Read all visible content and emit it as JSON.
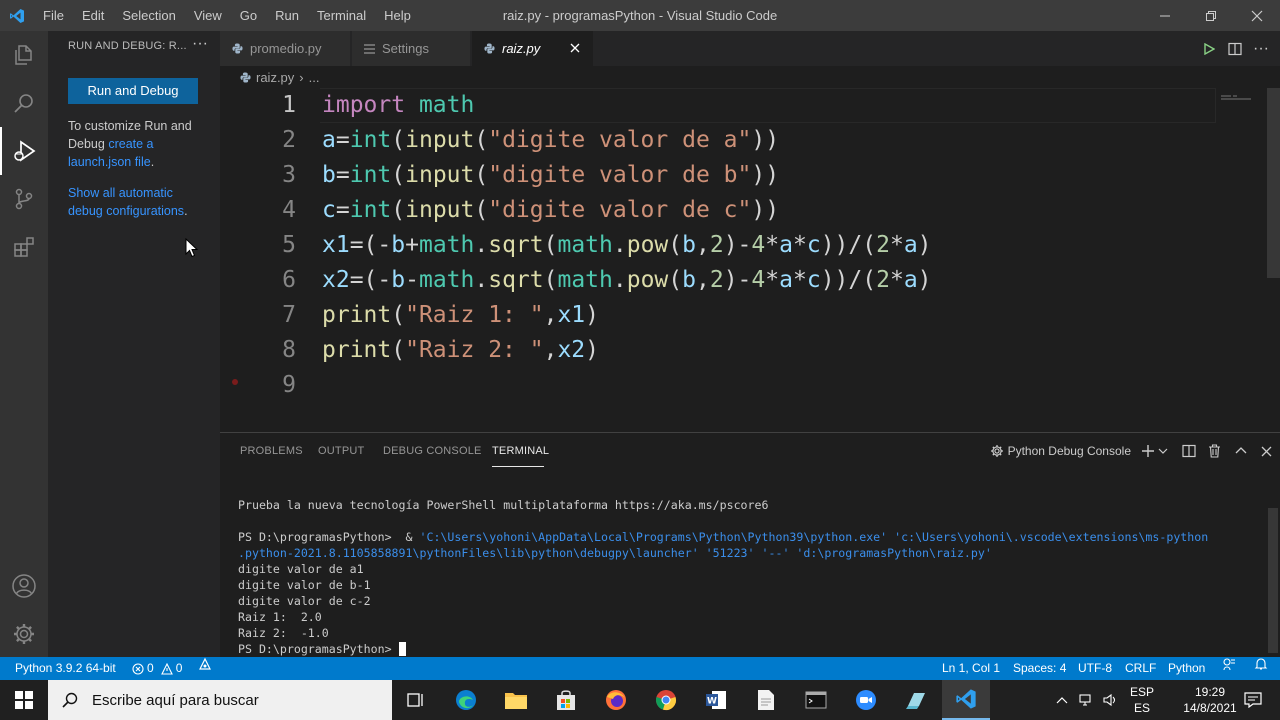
{
  "app": {
    "window_title": "raiz.py - programasPython - Visual Studio Code",
    "menu": [
      "File",
      "Edit",
      "Selection",
      "View",
      "Go",
      "Run",
      "Terminal",
      "Help"
    ]
  },
  "sidebar": {
    "title": "RUN AND DEBUG: R...",
    "run_debug_button": "Run and Debug",
    "text_prefix": "To customize Run and Debug",
    "create_link": "create a launch.json file",
    "text_suffix": ".",
    "show_link": "Show all automatic debug configurations",
    "show_suffix": "."
  },
  "tabs": [
    {
      "label": "promedio.py",
      "active": false
    },
    {
      "label": "Settings",
      "active": false
    },
    {
      "label": "raiz.py",
      "active": true
    }
  ],
  "breadcrumb": {
    "file": "raiz.py",
    "more": "..."
  },
  "editor": {
    "line_numbers": [
      "1",
      "2",
      "3",
      "4",
      "5",
      "6",
      "7",
      "8",
      "9"
    ]
  },
  "panel": {
    "tabs": [
      "PROBLEMS",
      "OUTPUT",
      "DEBUG CONSOLE",
      "TERMINAL"
    ],
    "active_tab": "TERMINAL",
    "console_select": "Python Debug Console",
    "terminal": {
      "line1": "Prueba la nueva tecnología PowerShell multiplataforma https://aka.ms/pscore6",
      "prompt1": "PS D:\\programasPython>  & ",
      "cmd": "'C:\\Users\\yohoni\\AppData\\Local\\Programs\\Python\\Python39\\python.exe' 'c:\\Users\\yohoni\\.vscode\\extensions\\ms-python",
      "cmd2": ".python-2021.8.1105858891\\pythonFiles\\lib\\python\\debugpy\\launcher' '51223' '--' 'd:\\programasPython\\raiz.py'",
      "out1": "digite valor de a1",
      "out2": "digite valor de b-1",
      "out3": "digite valor de c-2",
      "out4": "Raiz 1:  2.0",
      "out5": "Raiz 2:  -1.0",
      "prompt2": "PS D:\\programasPython> "
    }
  },
  "statusbar": {
    "python": "Python 3.9.2 64-bit",
    "errors": "0",
    "warnings": "0",
    "position": "Ln 1, Col 1",
    "spaces": "Spaces: 4",
    "encoding": "UTF-8",
    "eol": "CRLF",
    "language": "Python"
  },
  "taskbar": {
    "search_placeholder": "Escribe aquí para buscar",
    "lang1": "ESP",
    "lang2": "ES",
    "time": "19:29",
    "date": "14/8/2021"
  },
  "colors": {
    "accent": "#007acc",
    "button": "#0e639c",
    "link": "#3794ff"
  }
}
